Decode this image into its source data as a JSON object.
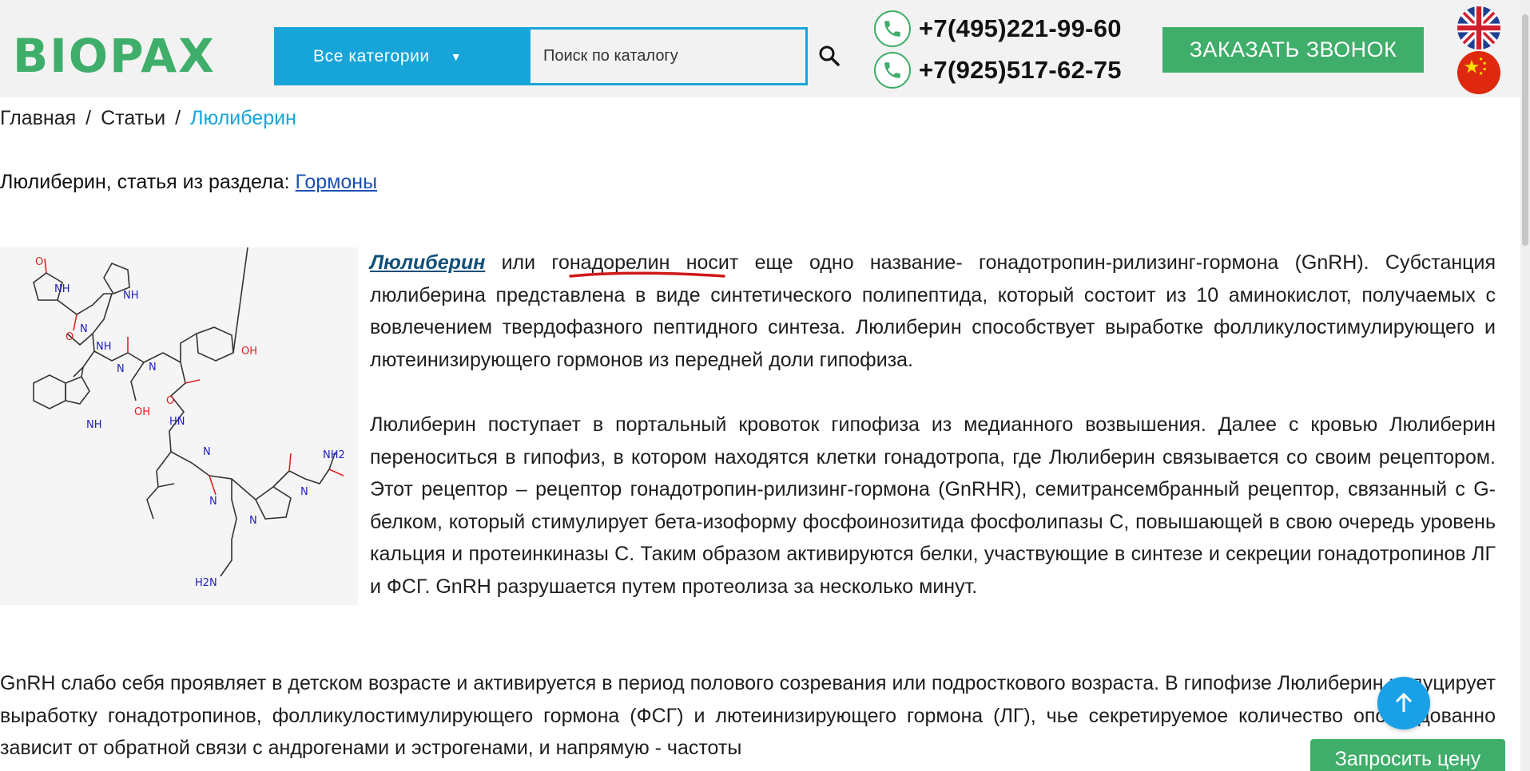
{
  "header": {
    "logo_text": "BIOPAX",
    "category_select": "Все категории",
    "search_placeholder": "Поиск по каталогу",
    "phones": [
      "+7(495)221-99-60",
      "+7(925)517-62-75"
    ],
    "callback_button": "ЗАКАЗАТЬ ЗВОНОК",
    "flags": [
      "uk-flag-icon",
      "china-flag-icon"
    ],
    "accent_color": "#17a5d9",
    "brand_color": "#3fae6a"
  },
  "breadcrumb": {
    "items": [
      "Главная",
      "Статьи"
    ],
    "current": "Люлиберин"
  },
  "section_line": {
    "prefix": "Люлиберин, статья из раздела: ",
    "link": "Гормоны"
  },
  "article": {
    "p1_lead": "Люлиберин",
    "p1_rest": " или гонадорелин носит еще одно название- гонадотропин-рилизинг-гормона (GnRH). Субстанция люлиберина представлена в виде синтетического полипептида, который состоит из 10 аминокислот, получаемых с вовлечением твердофазного пептидного синтеза. Люлиберин способствует выработке фолликулостимулирующего и лютеинизирующего гормонов из передней доли гипофиза.",
    "p2": "Люлиберин поступает в портальный кровоток гипофиза из медианного возвышения. Далее с кровью Люлиберин переноситься в гипофиз, в котором находятся клетки гонадотропа, где Люлиберин связывается со своим рецептором. Этот рецептор – рецептор гонадотропин-рилизинг-гормона (GnRHR), семитрансембранный рецептор, связанный с G-белком, который стимулирует бета-изоформу фосфоинозитида фосфолипазы С, повышающей в свою очередь уровень кальция и протеинкиназы С. Таким образом активируются белки, участвующие в синтезе и секреции гонадотропинов ЛГ и ФСГ. GnRH разрушается путем протеолиза за несколько минут.",
    "p3": "GnRH слабо себя проявляет в детском возрасте и активируется в период полового созревания или подросткового возраста. В гипофизе Люлиберин индуцирует выработку гонадотропинов, фолликулостимулирующего гормона (ФСГ) и лютеинизирующего гормона (ЛГ), чье секретируемое количество опосредованно зависит от обратной связи с андрогенами и эстрогенами, и напрямую - частоты"
  },
  "floating": {
    "scroll_top_icon": "arrow-up-icon",
    "request_price_button": "Запросить цену"
  }
}
